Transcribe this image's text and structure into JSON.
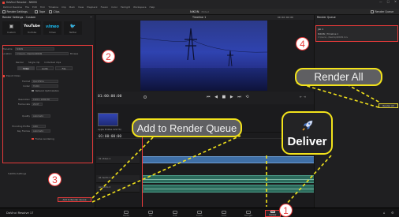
{
  "window": {
    "title": "DaVinci Resolve - NIKON",
    "controls": [
      "—",
      "□",
      "✕"
    ]
  },
  "menu": [
    "DaVinci Resolve",
    "File",
    "Edit",
    "Trim",
    "Timeline",
    "Clip",
    "Mark",
    "View",
    "Playback",
    "Fusion",
    "Color",
    "Fairlight",
    "Workspace",
    "Help"
  ],
  "toolbar": {
    "render_settings": "Render Settings",
    "tape": "Tape",
    "clips": "Clips",
    "project_name": "NIKON",
    "edited": "Edited",
    "render_queue": "Render Queue"
  },
  "left_panel": {
    "title": "Render Settings - Custom",
    "presets": [
      {
        "label": "Custom",
        "logo": "▣"
      },
      {
        "label": "YouTube",
        "logo": "YouTube"
      },
      {
        "label": "Vimeo",
        "logo": "vimeo"
      },
      {
        "label": "Twitter",
        "logo": "🐦"
      }
    ],
    "filename_label": "Filename",
    "filename_value": "NIKON",
    "location_label": "Location",
    "location_value": "C:\\Users\\...\\Desktop\\NIKON",
    "browse": "Browse",
    "render_label": "Render",
    "render_single": "Single clip",
    "render_individual": "Individual clips",
    "tabs": [
      "Video",
      "Audio",
      "File"
    ],
    "export_video": "Export Video",
    "format_label": "Format",
    "format_value": "QuickTime",
    "codec_label": "Codec",
    "codec_value": "H.264",
    "network_opt": "Network Optimization",
    "resolution_label": "Resolution",
    "resolution_value": "1920 x 1080 HD",
    "framerate_label": "Frame rate",
    "framerate_value": "29.97",
    "quality_label": "Quality",
    "quality_value": "Automatic",
    "encoding_label": "Encoding Profile",
    "encoding_value": "Auto",
    "keyframes_label": "Key Frames",
    "keyframes_value": "Automatic",
    "frame_reorder": "Frame reordering",
    "subtitle_settings": "Subtitle Settings",
    "add_to_queue": "Add to Render Queue"
  },
  "viewer": {
    "timeline_name": "Timeline 1",
    "timecode": "01:00:00:00",
    "clip_timecode": "00:00:00:00",
    "clip_name": "Apple ProRes 422 HQ"
  },
  "timeline": {
    "tracks": [
      {
        "name": "V1",
        "label": "Video 1"
      },
      {
        "name": "A1",
        "label": "Audio 1"
      },
      {
        "name": "A2",
        "label": "Audio 2"
      }
    ],
    "ruler_time": "01:00:00:00"
  },
  "render_queue": {
    "title": "Render Queue",
    "job_title": "Job 1",
    "job_detail": "NIKON | Timeline 1",
    "job_path": "C:\\Users\\...\\Desktop\\NIKON.mov",
    "render_all": "Render All"
  },
  "pages": [
    "Media",
    "Cut",
    "Edit",
    "Fusion",
    "Color",
    "Fairlight",
    "Deliver"
  ],
  "app_name": "DaVinci Resolve 17",
  "annotations": {
    "numbers": [
      "1",
      "2",
      "3",
      "4"
    ],
    "add_to_render_queue": "Add to Render Queue",
    "render_all": "Render All",
    "deliver": "Deliver"
  },
  "colors": {
    "highlight_red": "#e83a3a",
    "callout_yellow": "#f2e21b",
    "callout_bg": "#5f5f62"
  }
}
